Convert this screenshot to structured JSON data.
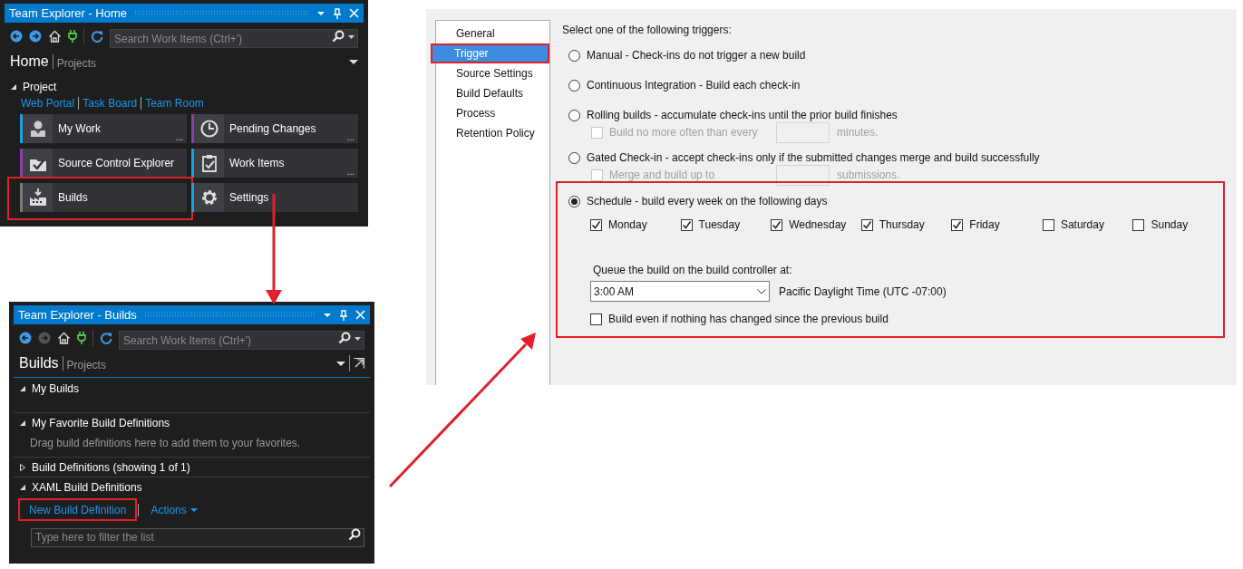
{
  "home_panel": {
    "title": "Team Explorer - Home",
    "search_placeholder": "Search Work Items (Ctrl+')",
    "forward_disabled": false,
    "header": {
      "title": "Home",
      "subtitle": "Projects"
    },
    "section": {
      "label": "Project",
      "expanded": true
    },
    "links": [
      "Web Portal",
      "Task Board",
      "Team Room"
    ],
    "tiles": [
      {
        "label": "My Work",
        "color": "#1ba1e2",
        "more": "...",
        "highlighted": false
      },
      {
        "label": "Pending Changes",
        "color": "#8b3fa8",
        "more": "...",
        "highlighted": false
      },
      {
        "label": "Source Control Explorer",
        "color": "#8b3fa8",
        "highlighted": false
      },
      {
        "label": "Work Items",
        "color": "#1ba1e2",
        "more": "...",
        "highlighted": false
      },
      {
        "label": "Builds",
        "color": "#7a7a7a",
        "highlighted": true
      },
      {
        "label": "Settings",
        "color": "#1ba1e2",
        "highlighted": false
      }
    ]
  },
  "builds_panel": {
    "title": "Team Explorer - Builds",
    "search_placeholder": "Search Work Items (Ctrl+')",
    "forward_disabled": true,
    "header": {
      "title": "Builds",
      "subtitle": "Projects"
    },
    "sections": [
      {
        "label": "My Builds",
        "expanded": true
      },
      {
        "label": "My Favorite Build Definitions",
        "expanded": true,
        "hint": "Drag build definitions here to add them to your favorites."
      },
      {
        "label": "Build Definitions (showing 1 of 1)",
        "expanded": false
      },
      {
        "label": "XAML Build Definitions",
        "expanded": true,
        "links": [
          {
            "label": "New Build Definition",
            "highlighted": true,
            "dropdown": false
          },
          {
            "label": "Actions",
            "highlighted": false,
            "dropdown": true
          }
        ],
        "filter_placeholder": "Type here to filter the list"
      }
    ]
  },
  "settings_panel": {
    "nav": [
      {
        "label": "General",
        "selected": false,
        "highlighted": false
      },
      {
        "label": "Trigger",
        "selected": true,
        "highlighted": true
      },
      {
        "label": "Source Settings",
        "selected": false,
        "highlighted": false
      },
      {
        "label": "Build Defaults",
        "selected": false,
        "highlighted": false
      },
      {
        "label": "Process",
        "selected": false,
        "highlighted": false
      },
      {
        "label": "Retention Policy",
        "selected": false,
        "highlighted": false
      }
    ],
    "prompt": "Select one of the following triggers:",
    "triggers": [
      {
        "label": "Manual - Check-ins do not trigger a new build",
        "selected": false
      },
      {
        "label": "Continuous Integration - Build each check-in",
        "selected": false
      },
      {
        "label": "Rolling builds - accumulate check-ins until the prior build finishes",
        "selected": false,
        "option": {
          "label": "Build no more often than every",
          "checked": false,
          "disabled": true,
          "unit": "minutes."
        }
      },
      {
        "label": "Gated Check-in - accept check-ins only if the submitted changes merge and build successfully",
        "selected": false,
        "option": {
          "label": "Merge and build up to",
          "checked": false,
          "disabled": true,
          "unit": "submissions."
        }
      },
      {
        "label": "Schedule - build every week on the following days",
        "selected": true,
        "highlighted": true,
        "days": [
          {
            "label": "Monday",
            "checked": true
          },
          {
            "label": "Tuesday",
            "checked": true
          },
          {
            "label": "Wednesday",
            "checked": true
          },
          {
            "label": "Thursday",
            "checked": true
          },
          {
            "label": "Friday",
            "checked": true
          },
          {
            "label": "Saturday",
            "checked": false
          },
          {
            "label": "Sunday",
            "checked": false
          }
        ],
        "queue_label": "Queue the build on the build controller at:",
        "time": "3:00 AM",
        "time_zone": "Pacific Daylight Time (UTC -07:00)",
        "force": {
          "label": "Build even if nothing has changed since the previous build",
          "checked": false
        }
      }
    ]
  }
}
